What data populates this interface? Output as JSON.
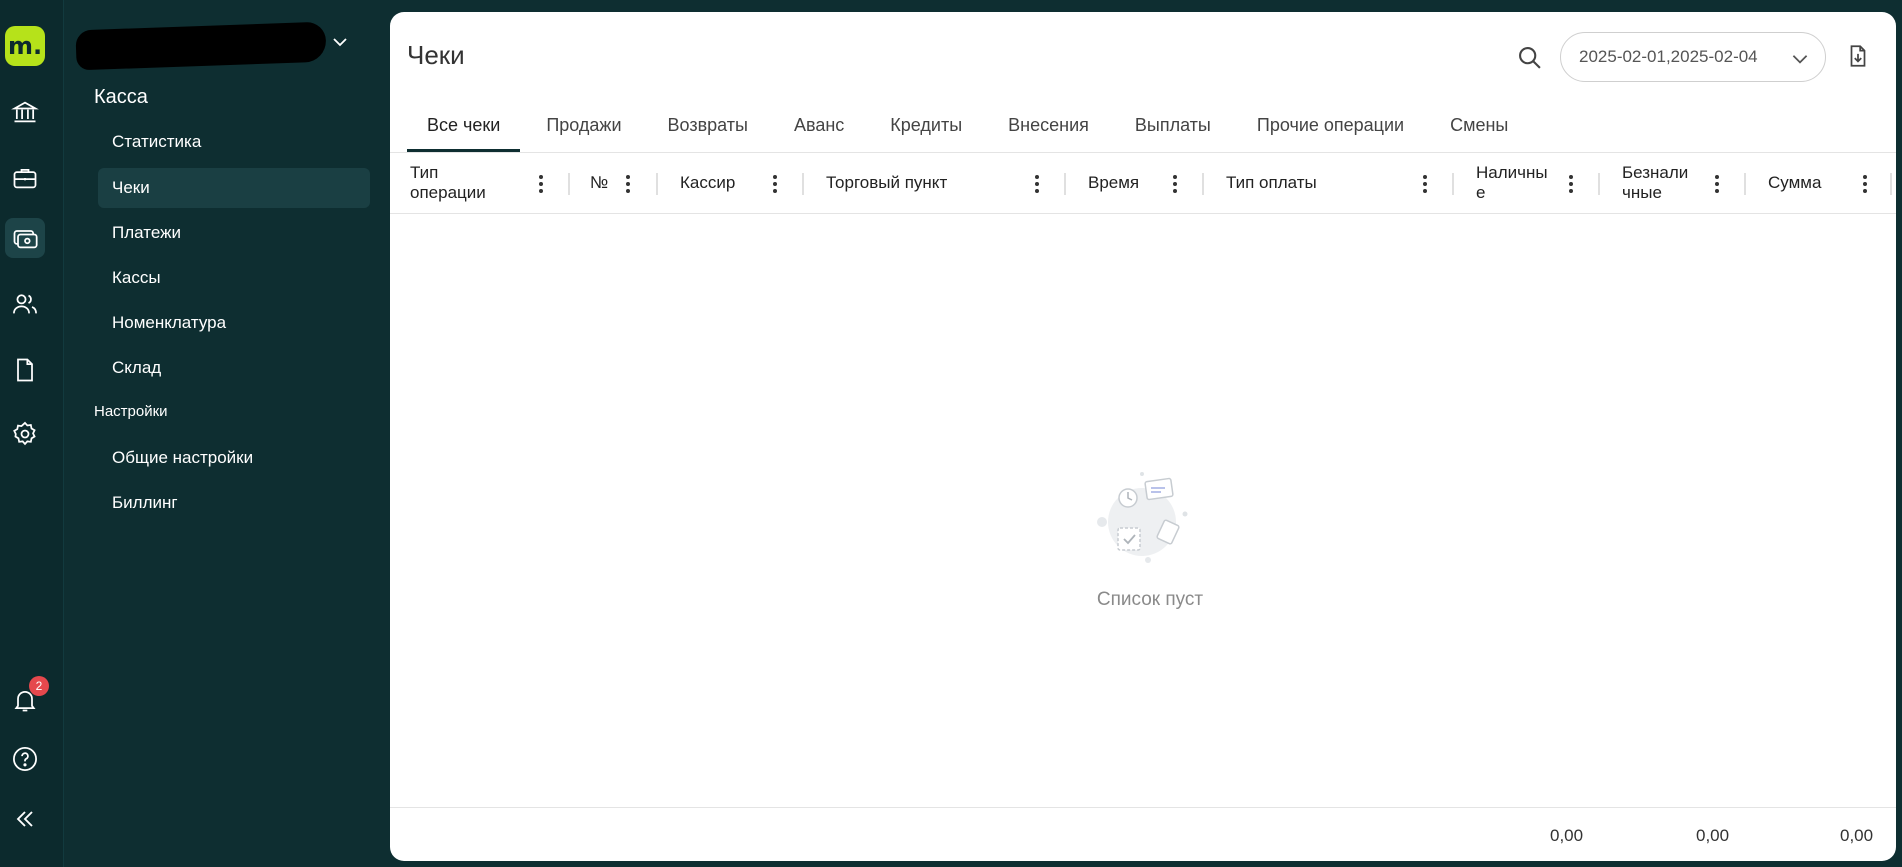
{
  "rail": {
    "logo_text": "m.",
    "notification_count": "2",
    "icons": [
      "bank-icon",
      "briefcase-icon",
      "cash-register-icon",
      "users-icon",
      "document-icon",
      "gear-icon",
      "bell-icon",
      "help-icon",
      "collapse-icon"
    ]
  },
  "nav": {
    "section_kassa": "Касса",
    "items_kassa": [
      "Статистика",
      "Чеки",
      "Платежи",
      "Кассы",
      "Номенклатура",
      "Склад"
    ],
    "section_settings": "Настройки",
    "items_settings": [
      "Общие настройки",
      "Биллинг"
    ]
  },
  "header": {
    "title": "Чеки",
    "date_range": "2025-02-01,2025-02-04"
  },
  "tabs": [
    "Все чеки",
    "Продажи",
    "Возвраты",
    "Аванс",
    "Кредиты",
    "Внесения",
    "Выплаты",
    "Прочие операции",
    "Смены"
  ],
  "table": {
    "columns": [
      "Тип\nоперации",
      "№",
      "Кассир",
      "Торговый пункт",
      "Время",
      "Тип оплаты",
      "Наличны\nе",
      "Безнали\nчные",
      "Сумма"
    ],
    "empty_text": "Список пуст",
    "totals": [
      "0,00",
      "0,00",
      "0,00"
    ]
  },
  "colors": {
    "sidebar_bg": "#0e2e31",
    "accent_logo": "#b6e21a",
    "badge": "#e5484d"
  }
}
